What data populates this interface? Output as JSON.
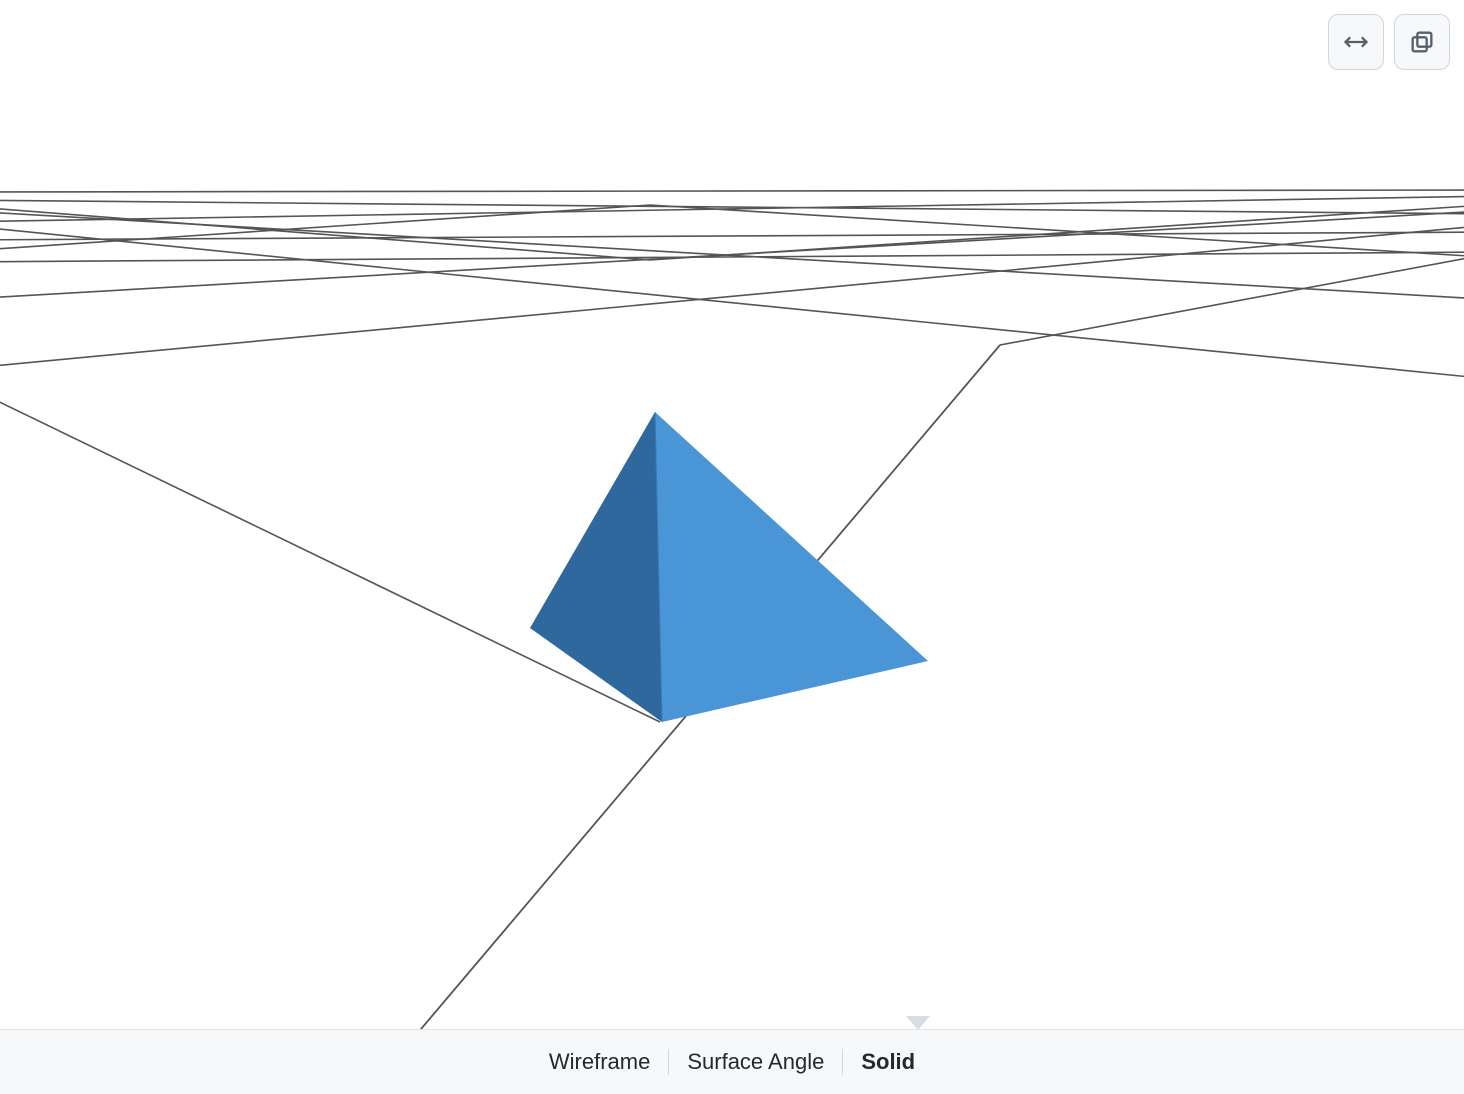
{
  "viewer": {
    "modes": {
      "wireframe_label": "Wireframe",
      "surface_angle_label": "Surface Angle",
      "solid_label": "Solid",
      "active": "solid"
    },
    "toolbar": {
      "expand_icon": "expand-horizontal-icon",
      "popout_icon": "popout-icon"
    },
    "model": {
      "face_color_light": "#4a95d6",
      "face_color_dark": "#2e689d",
      "grid_line_color": "#555555",
      "background": "#ffffff"
    }
  }
}
